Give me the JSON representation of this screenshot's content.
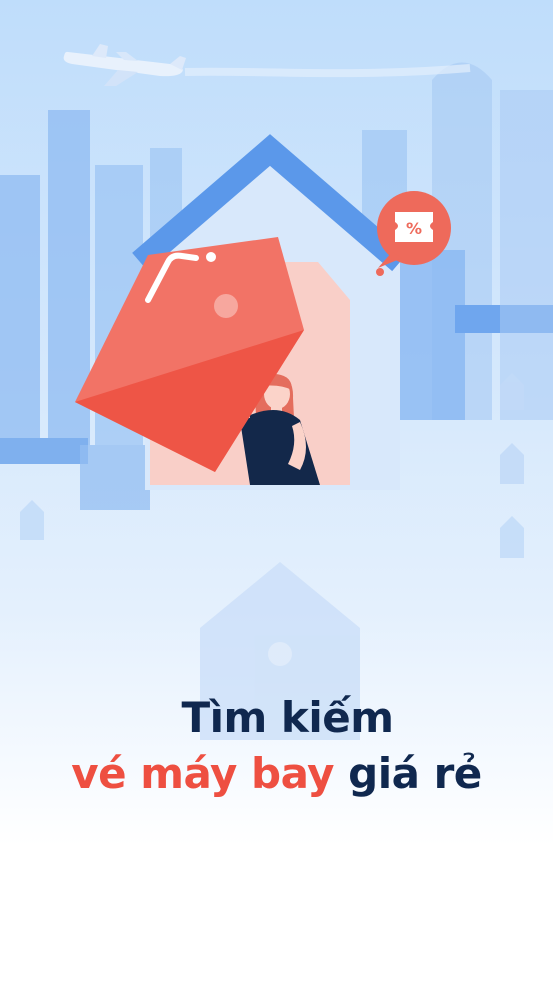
{
  "splash": {
    "headline": {
      "line1": "Tìm kiếm",
      "line2_accent": "vé máy bay",
      "line2_rest": "giá rẻ"
    },
    "badge_symbol": "%"
  },
  "colors": {
    "accent": "#EE4F41",
    "text_dark": "#10284F",
    "building_blue": "#7FB0EE",
    "roof_blue": "#4F8EE8",
    "tag_red": "#F06A5E"
  },
  "icons": [
    "airplane-icon",
    "discount-ticket-icon"
  ]
}
